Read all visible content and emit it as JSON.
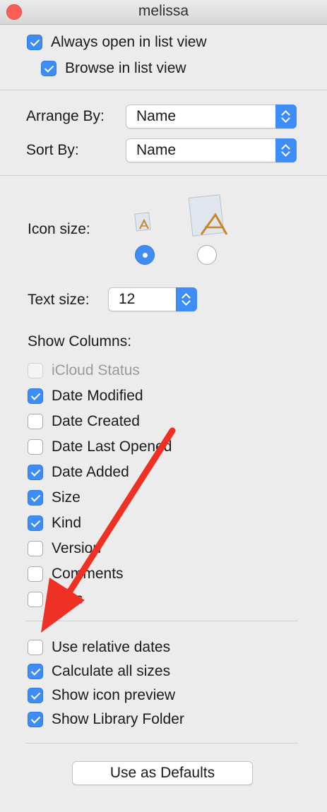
{
  "window": {
    "title": "melissa"
  },
  "top_options": [
    {
      "label": "Always open in list view",
      "checked": true
    },
    {
      "label": "Browse in list view",
      "checked": true
    }
  ],
  "arrange": {
    "label": "Arrange By:",
    "value": "Name"
  },
  "sort": {
    "label": "Sort By:",
    "value": "Name"
  },
  "icon_size": {
    "label": "Icon size:",
    "selected": "small"
  },
  "text_size": {
    "label": "Text size:",
    "value": "12"
  },
  "show_columns": {
    "heading": "Show Columns:",
    "items": [
      {
        "label": "iCloud Status",
        "checked": false,
        "disabled": true
      },
      {
        "label": "Date Modified",
        "checked": true
      },
      {
        "label": "Date Created",
        "checked": false
      },
      {
        "label": "Date Last Opened",
        "checked": false
      },
      {
        "label": "Date Added",
        "checked": true
      },
      {
        "label": "Size",
        "checked": true
      },
      {
        "label": "Kind",
        "checked": true
      },
      {
        "label": "Version",
        "checked": false
      },
      {
        "label": "Comments",
        "checked": false
      },
      {
        "label": "Tags",
        "checked": false
      }
    ]
  },
  "bottom_options": [
    {
      "label": "Use relative dates",
      "checked": false
    },
    {
      "label": "Calculate all sizes",
      "checked": true
    },
    {
      "label": "Show icon preview",
      "checked": true
    },
    {
      "label": "Show Library Folder",
      "checked": true
    }
  ],
  "defaults_button": {
    "label": "Use as Defaults"
  },
  "colors": {
    "accent": "#3e8df6",
    "annotation_arrow": "#ee3124",
    "close": "#fd5f57"
  },
  "annotation": {
    "type": "red-arrow",
    "points_to": "Use relative dates"
  }
}
